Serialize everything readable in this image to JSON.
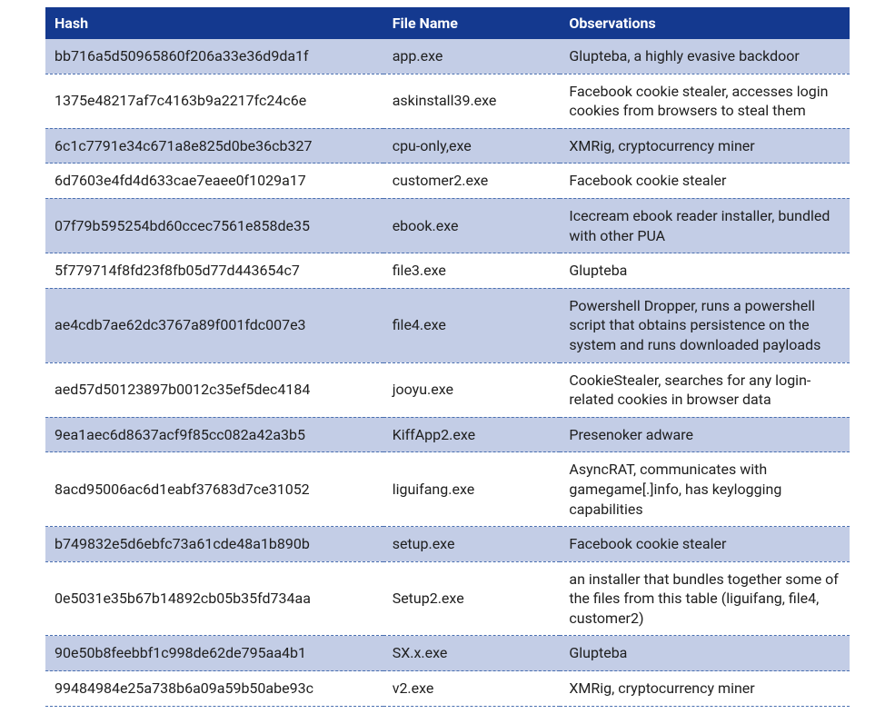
{
  "table": {
    "headers": {
      "hash": "Hash",
      "file": "File Name",
      "obs": "Observations"
    },
    "rows": [
      {
        "hash": "bb716a5d50965860f206a33e36d9da1f",
        "file": "app.exe",
        "obs": "Glupteba, a highly evasive backdoor"
      },
      {
        "hash": "1375e48217af7c4163b9a2217fc24c6e",
        "file": "askinstall39.exe",
        "obs": "Facebook cookie stealer, accesses login cookies from browsers to steal them"
      },
      {
        "hash": "6c1c7791e34c671a8e825d0be36cb327",
        "file": "cpu-only,exe",
        "obs": "XMRig, cryptocurrency miner"
      },
      {
        "hash": "6d7603e4fd4d633cae7eaee0f1029a17",
        "file": "customer2.exe",
        "obs": "Facebook cookie stealer"
      },
      {
        "hash": "07f79b595254bd60ccec7561e858de35",
        "file": "ebook.exe",
        "obs": "Icecream ebook reader installer, bundled with other PUA"
      },
      {
        "hash": "5f779714f8fd23f8fb05d77d443654c7",
        "file": "file3.exe",
        "obs": "Glupteba"
      },
      {
        "hash": "ae4cdb7ae62dc3767a89f001fdc007e3",
        "file": "file4.exe",
        "obs": "Powershell Dropper, runs a powershell script that obtains persistence on the system and runs downloaded payloads"
      },
      {
        "hash": "aed57d50123897b0012c35ef5dec4184",
        "file": "jooyu.exe",
        "obs": "CookieStealer, searches for any login-related cookies in browser data"
      },
      {
        "hash": "9ea1aec6d8637acf9f85cc082a42a3b5",
        "file": "KiffApp2.exe",
        "obs": "Presenoker adware"
      },
      {
        "hash": "8acd95006ac6d1eabf37683d7ce31052",
        "file": "liguifang.exe",
        "obs": "AsyncRAT, communicates with gamegame[.]info, has keylogging capabilities"
      },
      {
        "hash": "b749832e5d6ebfc73a61cde48a1b890b",
        "file": "setup.exe",
        "obs": "Facebook cookie stealer"
      },
      {
        "hash": "0e5031e35b67b14892cb05b35fd734aa",
        "file": "Setup2.exe",
        "obs": "an installer that bundles together some of the files from this table (liguifang, file4, customer2)"
      },
      {
        "hash": "90e50b8feebbf1c998de62de795aa4b1",
        "file": "SX.x.exe",
        "obs": "Glupteba"
      },
      {
        "hash": "99484984e25a738b6a09a59b50abe93c",
        "file": "v2.exe",
        "obs": "XMRig, cryptocurrency miner"
      }
    ]
  }
}
